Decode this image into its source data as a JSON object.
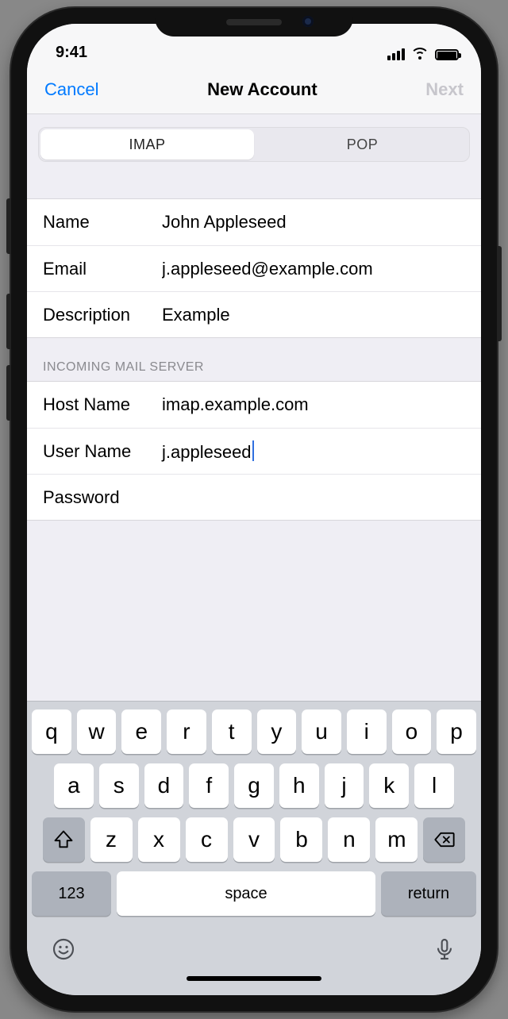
{
  "status": {
    "time": "9:41"
  },
  "nav": {
    "cancel": "Cancel",
    "title": "New Account",
    "next": "Next"
  },
  "tabs": {
    "imap": "IMAP",
    "pop": "POP",
    "selected": "IMAP"
  },
  "account": {
    "name_label": "Name",
    "name_value": "John Appleseed",
    "email_label": "Email",
    "email_value": "j.appleseed@example.com",
    "description_label": "Description",
    "description_value": "Example"
  },
  "incoming": {
    "header": "Incoming Mail Server",
    "host_label": "Host Name",
    "host_value": "imap.example.com",
    "user_label": "User Name",
    "user_value": "j.appleseed",
    "password_label": "Password",
    "password_value": ""
  },
  "keyboard": {
    "row1": [
      "q",
      "w",
      "e",
      "r",
      "t",
      "y",
      "u",
      "i",
      "o",
      "p"
    ],
    "row2": [
      "a",
      "s",
      "d",
      "f",
      "g",
      "h",
      "j",
      "k",
      "l"
    ],
    "row3": [
      "z",
      "x",
      "c",
      "v",
      "b",
      "n",
      "m"
    ],
    "numbers": "123",
    "space": "space",
    "return": "return"
  }
}
